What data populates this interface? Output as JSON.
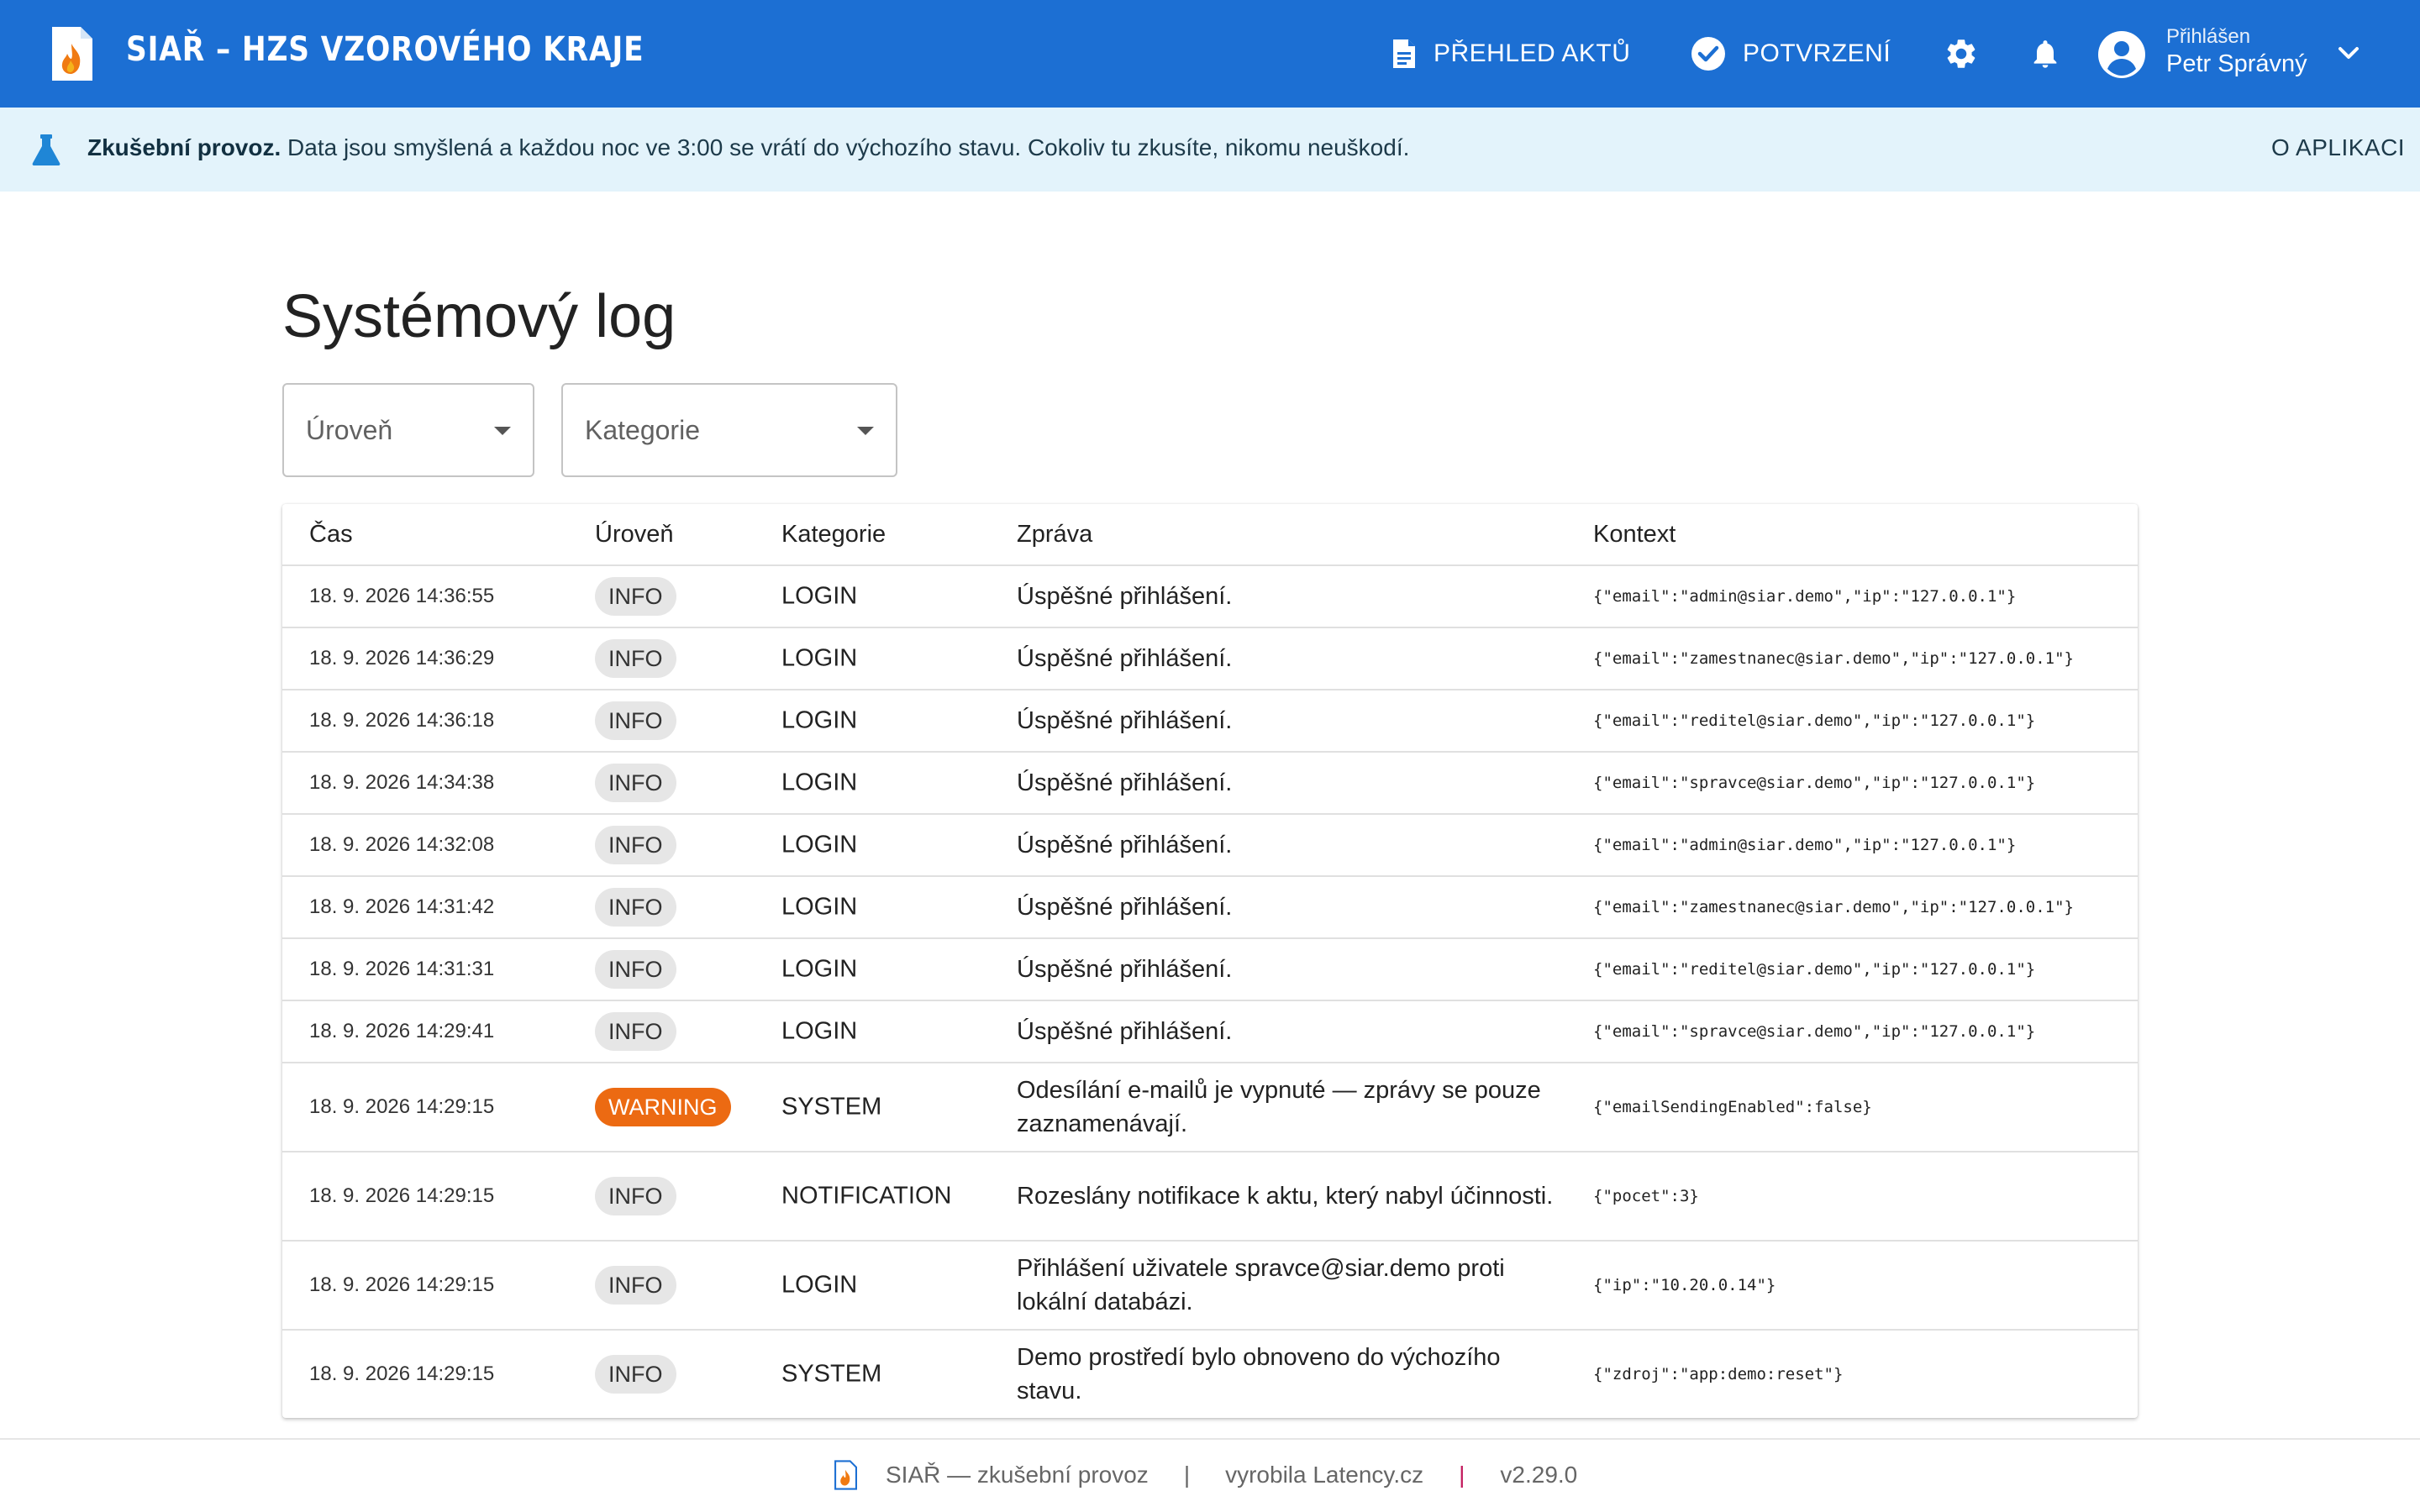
{
  "header": {
    "title": "SIAŘ – HZS VZOROVÉHO KRAJE",
    "nav_acts": "PŘEHLED AKTŮ",
    "nav_confirm": "POTVRZENÍ",
    "user_caption": "Přihlášen",
    "user_name": "Petr Správný"
  },
  "banner": {
    "strong": "Zkušební provoz.",
    "text": " Data jsou smyšlená a každou noc ve 3:00 se vrátí do výchozího stavu. Cokoliv tu zkusíte, nikomu neuškodí.",
    "about": "O APLIKACI"
  },
  "page": {
    "title": "Systémový log",
    "filter_level": "Úroveň",
    "filter_category": "Kategorie"
  },
  "table": {
    "headers": [
      "Čas",
      "Úroveň",
      "Kategorie",
      "Zpráva",
      "Kontext"
    ],
    "rows": [
      {
        "time": "18. 9. 2026 14:36:55",
        "level": "INFO",
        "category": "LOGIN",
        "message": "Úspěšné přihlášení.",
        "context": "{\"email\":\"admin@siar.demo\",\"ip\":\"127.0.0.1\"}"
      },
      {
        "time": "18. 9. 2026 14:36:29",
        "level": "INFO",
        "category": "LOGIN",
        "message": "Úspěšné přihlášení.",
        "context": "{\"email\":\"zamestnanec@siar.demo\",\"ip\":\"127.0.0.1\"}"
      },
      {
        "time": "18. 9. 2026 14:36:18",
        "level": "INFO",
        "category": "LOGIN",
        "message": "Úspěšné přihlášení.",
        "context": "{\"email\":\"reditel@siar.demo\",\"ip\":\"127.0.0.1\"}"
      },
      {
        "time": "18. 9. 2026 14:34:38",
        "level": "INFO",
        "category": "LOGIN",
        "message": "Úspěšné přihlášení.",
        "context": "{\"email\":\"spravce@siar.demo\",\"ip\":\"127.0.0.1\"}"
      },
      {
        "time": "18. 9. 2026 14:32:08",
        "level": "INFO",
        "category": "LOGIN",
        "message": "Úspěšné přihlášení.",
        "context": "{\"email\":\"admin@siar.demo\",\"ip\":\"127.0.0.1\"}"
      },
      {
        "time": "18. 9. 2026 14:31:42",
        "level": "INFO",
        "category": "LOGIN",
        "message": "Úspěšné přihlášení.",
        "context": "{\"email\":\"zamestnanec@siar.demo\",\"ip\":\"127.0.0.1\"}"
      },
      {
        "time": "18. 9. 2026 14:31:31",
        "level": "INFO",
        "category": "LOGIN",
        "message": "Úspěšné přihlášení.",
        "context": "{\"email\":\"reditel@siar.demo\",\"ip\":\"127.0.0.1\"}"
      },
      {
        "time": "18. 9. 2026 14:29:41",
        "level": "INFO",
        "category": "LOGIN",
        "message": "Úspěšné přihlášení.",
        "context": "{\"email\":\"spravce@siar.demo\",\"ip\":\"127.0.0.1\"}"
      },
      {
        "time": "18. 9. 2026 14:29:15",
        "level": "WARNING",
        "category": "SYSTEM",
        "message": "Odesílání e-mailů je vypnuté — zprávy se pouze zaznamenávají.",
        "context": "{\"emailSendingEnabled\":false}"
      },
      {
        "time": "18. 9. 2026 14:29:15",
        "level": "INFO",
        "category": "NOTIFICATION",
        "message": "Rozeslány notifikace k aktu, který nabyl účinnosti.",
        "context": "{\"pocet\":3}"
      },
      {
        "time": "18. 9. 2026 14:29:15",
        "level": "INFO",
        "category": "LOGIN",
        "message": "Přihlášení uživatele spravce@siar.demo proti lokální databázi.",
        "context": "{\"ip\":\"10.20.0.14\"}"
      },
      {
        "time": "18. 9. 2026 14:29:15",
        "level": "INFO",
        "category": "SYSTEM",
        "message": "Demo prostředí bylo obnoveno do výchozího stavu.",
        "context": "{\"zdroj\":\"app:demo:reset\"}"
      }
    ]
  },
  "footer": {
    "product": "SIAŘ — zkušební provoz",
    "maker": "vyrobila Latency.cz",
    "version": "v2.29.0"
  },
  "colors": {
    "appbar": "#1c6fd3",
    "banner": "#e3f3fb",
    "warning": "#ec6a12",
    "info_chip": "#e6e6e6"
  },
  "icons": [
    "logo-icon",
    "document-icon",
    "check-circle-icon",
    "gear-icon",
    "bell-icon",
    "account-circle-icon",
    "chevron-down-icon",
    "flask-icon",
    "dropdown-caret-icon"
  ]
}
